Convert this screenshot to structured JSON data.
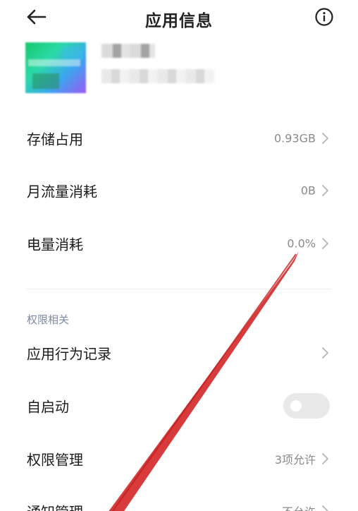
{
  "header": {
    "title": "应用信息",
    "back_icon": "arrow-left-icon",
    "info_icon": "info-circle-icon"
  },
  "usage_rows": [
    {
      "label": "存储占用",
      "value": "0.93GB"
    },
    {
      "label": "月流量消耗",
      "value": "0B"
    },
    {
      "label": "电量消耗",
      "value": "0.0%"
    }
  ],
  "permissions": {
    "section_title": "权限相关",
    "behavior_record": {
      "label": "应用行为记录"
    },
    "autostart": {
      "label": "自启动",
      "enabled": false
    },
    "permission_manage": {
      "label": "权限管理",
      "value": "3项允许"
    },
    "notification_manage": {
      "label": "通知管理",
      "value": "不允许"
    }
  },
  "colors": {
    "annotation_arrow": "#d42a2a",
    "section_title": "#7d8aa6",
    "value_text": "#8a8a8a"
  }
}
